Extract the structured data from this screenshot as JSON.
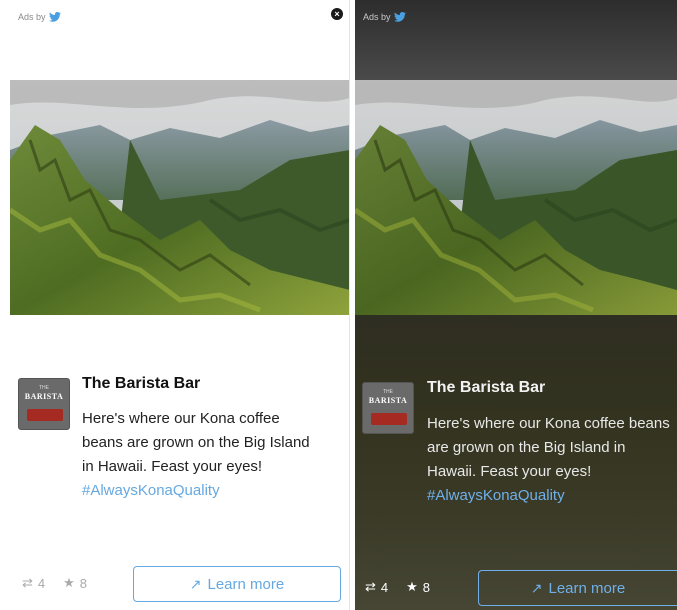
{
  "ad": {
    "ads_by": "Ads by",
    "brand_name": "The Barista Bar",
    "body_main": "Here's where our Kona coffee beans are grown on the Big Island in Hawaii. Feast your eyes! ",
    "hashtag": "#AlwaysKonaQuality",
    "retweets": "4",
    "favorites": "8",
    "cta_label": "Learn more",
    "logo_top": "THE",
    "logo_name": "BARISTA"
  },
  "icons": {
    "bird": "twitter-bird-icon",
    "close": "close-icon",
    "retweet": "retweet-icon",
    "star": "star-icon",
    "arrow": "arrow-up-right-icon"
  },
  "colors": {
    "link_blue": "#66a8e0",
    "dark_panel": "#3a3a3a",
    "accent_logo": "#a52a22"
  }
}
